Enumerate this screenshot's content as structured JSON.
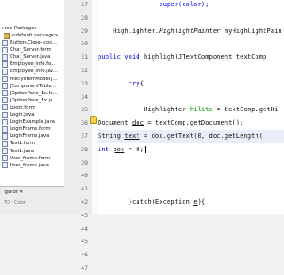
{
  "project": {
    "header": "urce Packages",
    "package": "<default package>",
    "files": [
      "Button-Close-icon...",
      "Chat_Server.form",
      "Chat_Server.java",
      "Employee_info.fo...",
      "Employee_info.jav...",
      "FileSystemModel.j...",
      "JComponentTable...",
      "JOptionPane_Ex.fo...",
      "JOptionPane_Ex.ja...",
      "Login.form",
      "Login.java",
      "LoginExample.java",
      "LoginFrame.form",
      "LoginFrame.java",
      "Test1.form",
      "Test1.java",
      "User_frame.form",
      "User_frame.java"
    ]
  },
  "navigator": {
    "tab_label": "igator ✕",
    "sub_label": "PD - Color"
  },
  "editor": {
    "line_numbers": [
      "27",
      "28",
      "29",
      "30",
      "31",
      "32",
      "33",
      "34",
      "35",
      "36",
      "37",
      "38",
      "39",
      "40",
      "41",
      "42",
      "43",
      "44",
      "45",
      "46",
      "47"
    ],
    "lines": {
      "l27": "                super(color);",
      "l29": "    Highlighter.",
      "l29_b": "HighlightPainter",
      "l29_c": " myHighlightPain",
      "l31_a": "public void",
      "l31_b": " highligh(JTextComponent textComp",
      "l33_a": "        try",
      "l33_b": "{",
      "l35_a": "            Highlighter ",
      "l35_b": "hilite",
      "l35_c": " = textComp.getHi",
      "l36_a": "Document ",
      "l36_b": "doc",
      "l36_c": " = textComp.getDocument();",
      "l37_a": "String ",
      "l37_b": "text",
      "l37_c": " = doc.getText(0, doc.getLength(",
      "l38_a": "int ",
      "l38_b": "pos",
      "l38_c": " = 0;",
      "l42_a": "        }catch(Exception ",
      "l42_b": "e",
      "l42_c": "){",
      "l46": "            }"
    }
  },
  "colors": {
    "keyword": "#0000e6",
    "line_highlight": "#e9eff8",
    "gutter": "#ececec"
  }
}
